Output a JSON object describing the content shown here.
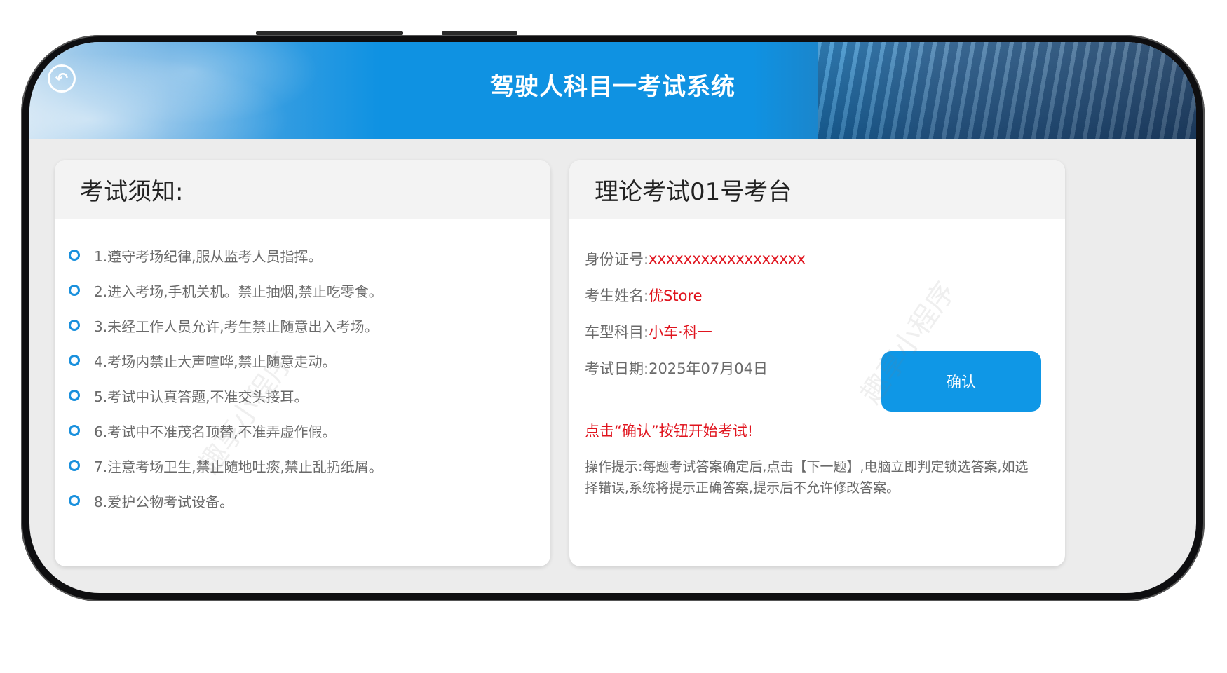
{
  "header": {
    "title": "驾驶人科目一考试系统"
  },
  "left_card": {
    "title": "考试须知:",
    "rules": [
      "1.遵守考场纪律,服从监考人员指挥。",
      "2.进入考场,手机关机。禁止抽烟,禁止吃零食。",
      "3.未经工作人员允许,考生禁止随意出入考场。",
      "4.考场内禁止大声喧哗,禁止随意走动。",
      "5.考试中认真答题,不准交头接耳。",
      "6.考试中不准茂名顶替,不准弄虚作假。",
      "7.注意考场卫生,禁止随地吐痰,禁止乱扔纸屑。",
      "8.爱护公物考试设备。"
    ]
  },
  "right_card": {
    "title": "理论考试01号考台",
    "id_label": "身份证号:",
    "id_value": "xxxxxxxxxxxxxxxxxx",
    "name_label": "考生姓名:",
    "name_value": "优Store",
    "type_label": "车型科目:",
    "type_value": "小车·科一",
    "date_label": "考试日期:",
    "date_value": "2025年07月04日",
    "confirm_label": "确认",
    "prompt": "点击“确认”按钮开始考试!",
    "tip": "操作提示:每题考试答案确定后,点击【下一题】,电脑立即判定锁选答案,如选择错误,系统将提示正确答案,提示后不允许修改答案。"
  },
  "watermark": "趣享小程序",
  "colors": {
    "accent": "#0f97e6",
    "highlight": "#e0141e"
  },
  "icons": {
    "back": "back-arrow-icon",
    "bullet": "bullet-circle-icon"
  }
}
